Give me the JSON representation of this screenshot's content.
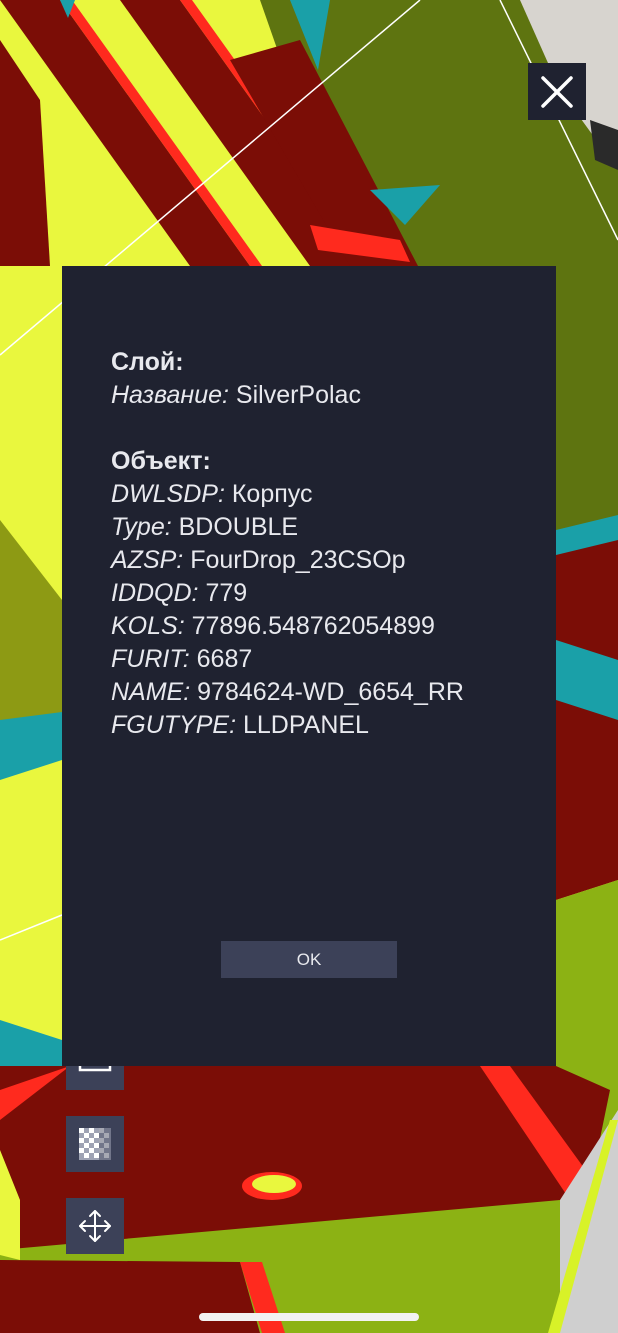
{
  "colors": {
    "panel_bg": "#1f2230",
    "button_bg": "#3c4158",
    "text": "#e8e9ee",
    "scene_yellow": "#e8f540",
    "scene_red": "#7d0d06",
    "scene_olive": "#5f7512",
    "scene_teal": "#1aa0a8"
  },
  "toolbar": {
    "close_icon": "close-icon",
    "tools": [
      {
        "icon": "ruler-icon"
      },
      {
        "icon": "checkerboard-icon"
      },
      {
        "icon": "move-arrows-icon"
      }
    ]
  },
  "dialog": {
    "layer_heading": "Слой:",
    "layer_props": [
      {
        "key": "Название:",
        "value": "SilverPolac"
      }
    ],
    "object_heading": "Объект:",
    "object_props": [
      {
        "key": "DWLSDP:",
        "value": "Корпус"
      },
      {
        "key": "Type:",
        "value": "BDOUBLE"
      },
      {
        "key": "AZSP:",
        "value": "FourDrop_23CSOp"
      },
      {
        "key": "IDDQD:",
        "value": "779"
      },
      {
        "key": "KOLS:",
        "value": "77896.548762054899"
      },
      {
        "key": "FURIT:",
        "value": "6687"
      },
      {
        "key": "NAME:",
        "value": "9784624-WD_6654_RR"
      },
      {
        "key": "FGUTYPE:",
        "value": "LLDPANEL"
      }
    ],
    "ok_label": "OK"
  }
}
